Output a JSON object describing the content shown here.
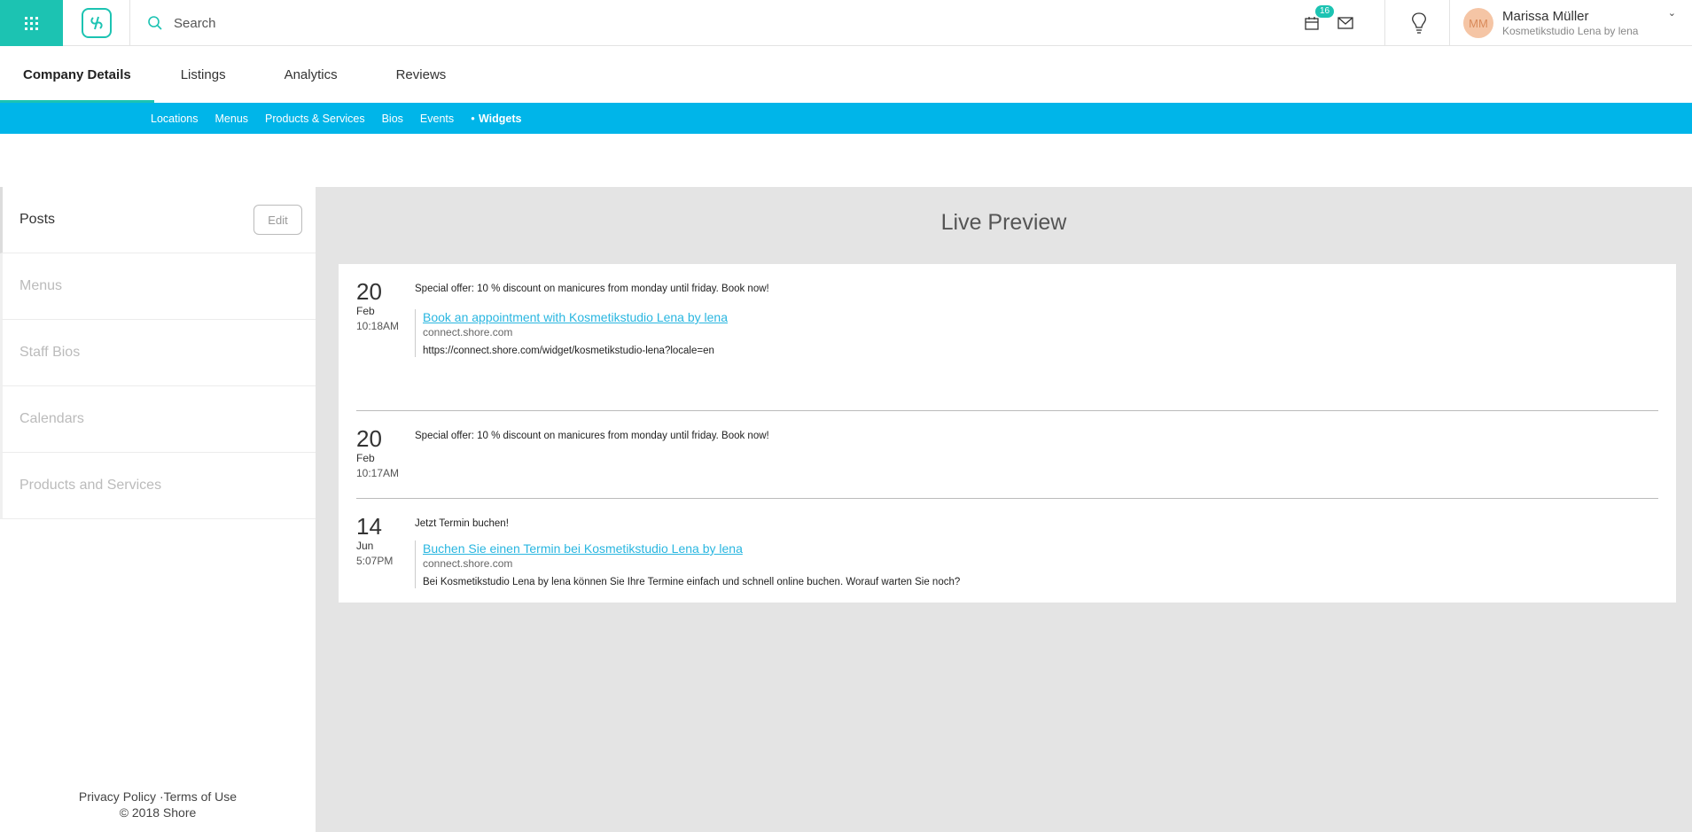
{
  "topbar": {
    "search_placeholder": "Search",
    "notification_count": "16",
    "user_initials": "MM",
    "user_name": "Marissa Müller",
    "user_company": "Kosmetikstudio Lena by lena"
  },
  "tabs": [
    {
      "label": "Company Details",
      "active": true
    },
    {
      "label": "Listings"
    },
    {
      "label": "Analytics"
    },
    {
      "label": "Reviews"
    }
  ],
  "subnav": [
    {
      "label": "Locations"
    },
    {
      "label": "Menus"
    },
    {
      "label": "Products & Services"
    },
    {
      "label": "Bios"
    },
    {
      "label": "Events"
    },
    {
      "label": "Widgets",
      "active": true
    }
  ],
  "sidebar": {
    "items": [
      {
        "label": "Posts",
        "active": true
      },
      {
        "label": "Menus"
      },
      {
        "label": "Staff Bios"
      },
      {
        "label": "Calendars"
      },
      {
        "label": "Products and Services"
      }
    ],
    "edit_label": "Edit"
  },
  "footer": {
    "privacy": "Privacy Policy",
    "terms": "Terms of Use",
    "copyright": "© 2018 Shore"
  },
  "preview": {
    "title": "Live Preview",
    "posts": [
      {
        "day": "20",
        "month": "Feb",
        "time": "10:18AM",
        "message": "Special offer: 10 % discount on manicures from monday until friday. Book now!",
        "link_title": "Book an appointment with Kosmetikstudio Lena by lena",
        "link_domain": "connect.shore.com",
        "link_desc": "https://connect.shore.com/widget/kosmetikstudio-lena?locale=en"
      },
      {
        "day": "20",
        "month": "Feb",
        "time": "10:17AM",
        "message": "Special offer: 10 % discount on manicures from monday until friday. Book now!"
      },
      {
        "day": "14",
        "month": "Jun",
        "time": "5:07PM",
        "message": "Jetzt Termin buchen!",
        "link_title": "Buchen Sie einen Termin bei Kosmetikstudio Lena by lena",
        "link_domain": "connect.shore.com",
        "link_desc": "Bei Kosmetikstudio Lena by lena können Sie Ihre Termine einfach und schnell online buchen. Worauf warten Sie noch?"
      }
    ]
  },
  "colors": {
    "brand_teal": "#1cc3b2",
    "subnav_blue": "#00b5e9",
    "link_blue": "#29b6e0"
  }
}
